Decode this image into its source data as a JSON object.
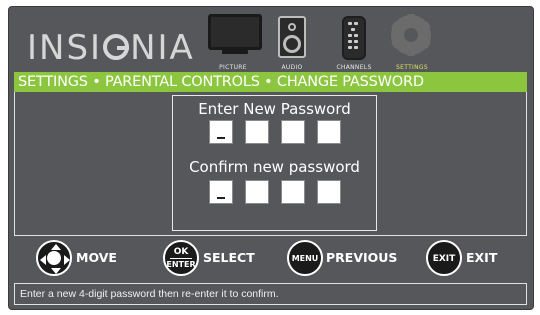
{
  "brand": {
    "name": "INSIGNIA",
    "left": "INSI",
    "right": "NIA"
  },
  "menu": [
    {
      "id": "picture",
      "label": "PICTURE",
      "icon": "tv-icon",
      "active": false
    },
    {
      "id": "audio",
      "label": "AUDIO",
      "icon": "speaker-icon",
      "active": false
    },
    {
      "id": "channels",
      "label": "CHANNELS",
      "icon": "remote-icon",
      "active": false
    },
    {
      "id": "settings",
      "label": "SETTINGS",
      "icon": "gear-icon",
      "active": true
    }
  ],
  "breadcrumb": "SETTINGS • PARENTAL CONTROLS • CHANGE PASSWORD",
  "password": {
    "enter_title": "Enter New Password",
    "confirm_title": "Confirm new password",
    "digits_count": 4
  },
  "nav": {
    "move": {
      "label": "MOVE",
      "icon": "arrows-icon"
    },
    "select": {
      "label": "SELECT",
      "key_top": "OK",
      "key_bottom": "ENTER"
    },
    "previous": {
      "label": "PREVIOUS",
      "key": "MENU"
    },
    "exit": {
      "label": "EXIT",
      "key": "EXIT"
    }
  },
  "help_text": "Enter a new 4-digit password then re-enter it to confirm.",
  "colors": {
    "background": "#55575a",
    "accent_green": "#8cc63f",
    "active_label": "#e3e068"
  }
}
